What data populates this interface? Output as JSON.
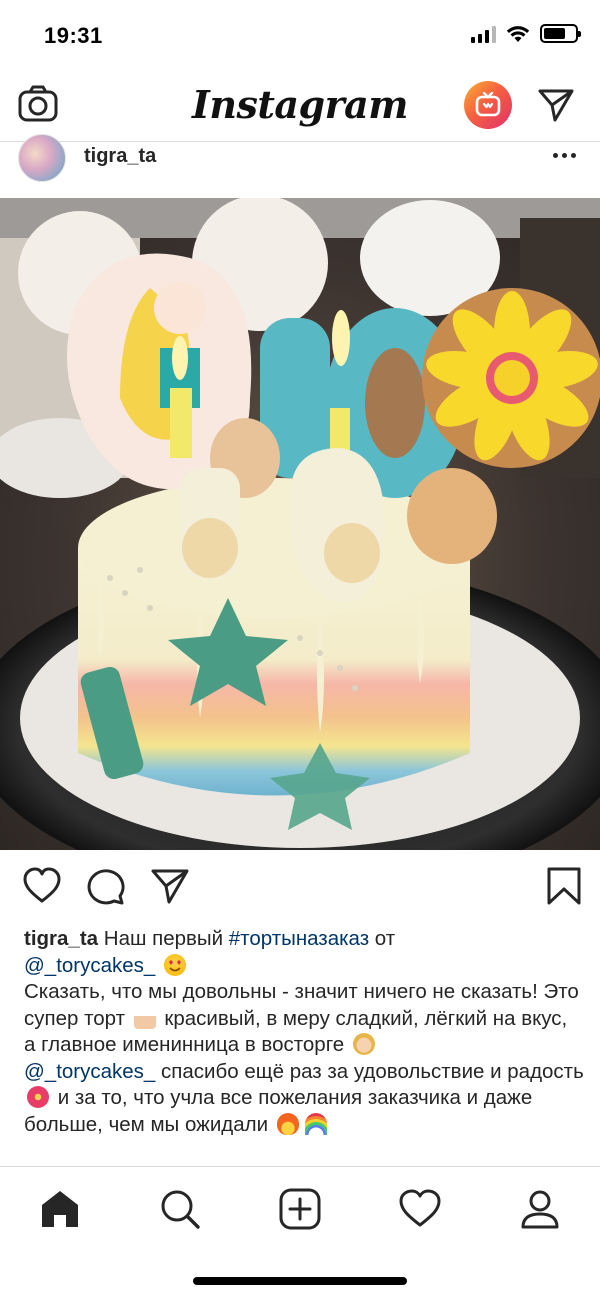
{
  "status_bar": {
    "time": "19:31"
  },
  "header": {
    "logo": "Instagram"
  },
  "post": {
    "username": "tigra_ta",
    "image_icon": "photo-birthday-cake"
  },
  "caption": {
    "username": "tigra_ta",
    "line1_text": " Наш первый ",
    "hashtag": "#тортыназаказ",
    "line1_tail": " от",
    "mention1": "@_torycakes_",
    "body1": "Сказать, что мы довольны - значит ничего не сказать! Это супер торт",
    "body2": " красивый, в меру сладкий, лёгкий на вкус, а главное именинница в восторге",
    "mention2": "@_torycakes_",
    "body3": "  спасибо ещё раз за  удовольствие и радость",
    "body4": "  и за то, что учла все пожелания заказчика и даже больше, чем мы ожидали",
    "emojis": [
      "heart-eyes-emoji",
      "cake-emoji",
      "princess-emoji",
      "hibiscus-emoji",
      "fire-emoji",
      "rainbow-emoji"
    ]
  },
  "tab_bar": {
    "items": [
      "home-icon",
      "search-icon",
      "new-post-icon",
      "activity-icon",
      "profile-icon"
    ]
  },
  "colors": {
    "link": "#003569",
    "text": "#262626",
    "border": "#dbdbdb"
  }
}
